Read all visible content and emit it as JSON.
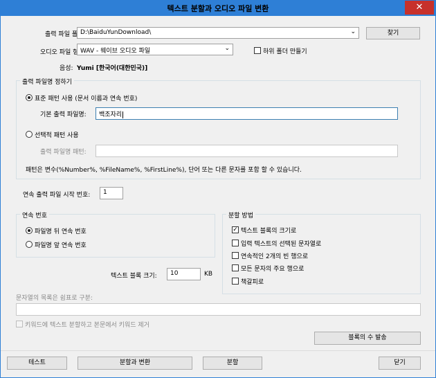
{
  "window": {
    "title": "텍스트 분할과 오디오 파일 변환",
    "close_glyph": "✕"
  },
  "output_folder": {
    "label": "출력 파일 폴더:",
    "value": "D:\\BaiduYunDownload\\",
    "browse_label": "찾기"
  },
  "audio_format": {
    "label": "오디오 파일 형식:",
    "value": "WAV - 웨이브 오디오 파일",
    "subfolder_label": "하위 폴더 만들기",
    "subfolder_checked": false
  },
  "voice": {
    "label": "음성:",
    "value": "Yumi [한국어(대한민국)]"
  },
  "naming": {
    "title": "출력 파일명 정하기",
    "standard_label": "표준 패턴 사용 (문서 이름과 연속 번호)",
    "standard_checked": true,
    "base_name_label": "기본 출력 파일명:",
    "base_name_value": "백조자리",
    "custom_label": "선택적 패턴 사용",
    "custom_checked": false,
    "pattern_label": "출력 파일명 패턴:",
    "pattern_value": "",
    "hint": "패턴은 변수(%Number%, %FileName%, %FirstLine%), 단어 또는 다른 문자를 포함 할 수 있습니다."
  },
  "start_number": {
    "label": "연속 출력 파일 시작 번호:",
    "value": "1"
  },
  "sequence": {
    "title": "연속 번호",
    "options": [
      {
        "label": "파일명 뒤 연속 번호",
        "checked": true
      },
      {
        "label": "파일명 앞 연속 번호",
        "checked": false
      }
    ]
  },
  "split_method": {
    "title": "분할 방법",
    "options": [
      {
        "label": "텍스트 블록의 크기로",
        "checked": true
      },
      {
        "label": "입력 텍스트의 선택된 문자열로",
        "checked": false
      },
      {
        "label": "연속적인 2개의 빈 행으로",
        "checked": false
      },
      {
        "label": "모든 문자의 주요 행으로",
        "checked": false
      },
      {
        "label": "책갈피로",
        "checked": false
      }
    ]
  },
  "block_size": {
    "label": "텍스트 블록 크기:",
    "value": "10",
    "unit": "KB"
  },
  "string_list": {
    "label": "문자열의 목록은 쉼표로 구분:",
    "value": ""
  },
  "keyword": {
    "label": "키워드에 텍스트 분할하고 본문에서 키워드 제거",
    "checked": false
  },
  "block_count_label": "블록의 수 발송",
  "bottom": {
    "test_label": "테스트",
    "split_convert_label": "분할과 변환",
    "split_label": "분할",
    "close_label": "닫기"
  },
  "glyphs": {
    "check": "✓",
    "dropdown": "⌄"
  }
}
